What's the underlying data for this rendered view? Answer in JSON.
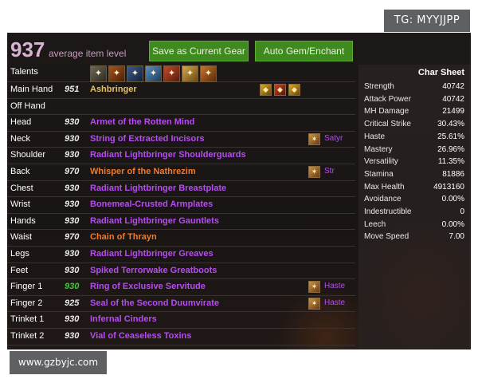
{
  "watermarks": {
    "top": "TG: MYYJJPP",
    "bottom": "www.gzbyjc.com"
  },
  "header": {
    "avg_ilvl": "937",
    "avg_label": "average item level",
    "save_button": "Save as Current Gear",
    "gem_button": "Auto Gem/Enchant"
  },
  "talents_label": "Talents",
  "talent_icons": [
    "talent-1",
    "talent-2",
    "talent-3",
    "talent-4",
    "talent-5",
    "talent-6",
    "talent-7"
  ],
  "gear": [
    {
      "slot": "Main Hand",
      "ilvl": "951",
      "item": "Ashbringer",
      "quality": "art",
      "relics": [
        "relic-holy",
        "relic-fire",
        "relic-holy"
      ]
    },
    {
      "slot": "Off Hand",
      "ilvl": "",
      "item": "",
      "quality": "epic"
    },
    {
      "slot": "Head",
      "ilvl": "930",
      "item": "Armet of the Rotten Mind",
      "quality": "epic"
    },
    {
      "slot": "Neck",
      "ilvl": "930",
      "item": "String of Extracted Incisors",
      "quality": "epic",
      "enchant": "Satyr"
    },
    {
      "slot": "Shoulder",
      "ilvl": "930",
      "item": "Radiant Lightbringer Shoulderguards",
      "quality": "epic"
    },
    {
      "slot": "Back",
      "ilvl": "970",
      "item": "Whisper of the Nathrezim",
      "quality": "leg",
      "enchant": "Str"
    },
    {
      "slot": "Chest",
      "ilvl": "930",
      "item": "Radiant Lightbringer Breastplate",
      "quality": "epic"
    },
    {
      "slot": "Wrist",
      "ilvl": "930",
      "item": "Bonemeal-Crusted Armplates",
      "quality": "epic"
    },
    {
      "slot": "Hands",
      "ilvl": "930",
      "item": "Radiant Lightbringer Gauntlets",
      "quality": "epic"
    },
    {
      "slot": "Waist",
      "ilvl": "970",
      "item": "Chain of Thrayn",
      "quality": "leg"
    },
    {
      "slot": "Legs",
      "ilvl": "930",
      "item": "Radiant Lightbringer Greaves",
      "quality": "epic"
    },
    {
      "slot": "Feet",
      "ilvl": "930",
      "item": "Spiked Terrorwake Greatboots",
      "quality": "epic"
    },
    {
      "slot": "Finger 1",
      "ilvl": "930",
      "ilvl_color": "green",
      "item": "Ring of Exclusive Servitude",
      "quality": "epic",
      "enchant": "Haste"
    },
    {
      "slot": "Finger 2",
      "ilvl": "925",
      "item": "Seal of the Second Duumvirate",
      "quality": "epic",
      "enchant": "Haste"
    },
    {
      "slot": "Trinket 1",
      "ilvl": "930",
      "item": "Infernal Cinders",
      "quality": "epic"
    },
    {
      "slot": "Trinket 2",
      "ilvl": "930",
      "item": "Vial of Ceaseless Toxins",
      "quality": "epic"
    }
  ],
  "char_sheet": {
    "title": "Char Sheet",
    "stats": [
      {
        "name": "Strength",
        "value": "40742"
      },
      {
        "name": "Attack Power",
        "value": "40742"
      },
      {
        "name": "MH Damage",
        "value": "21499"
      },
      {
        "name": "Critical Strike",
        "value": "30.43%"
      },
      {
        "name": "Haste",
        "value": "25.61%"
      },
      {
        "name": "Mastery",
        "value": "26.96%"
      },
      {
        "name": "Versatility",
        "value": "11.35%"
      },
      {
        "name": "Stamina",
        "value": "81886"
      },
      {
        "name": "Max Health",
        "value": "4913160"
      },
      {
        "name": "Avoidance",
        "value": "0.00%"
      },
      {
        "name": "Indestructible",
        "value": "0"
      },
      {
        "name": "Leech",
        "value": "0.00%"
      },
      {
        "name": "Move Speed",
        "value": "7.00"
      }
    ]
  },
  "colors": {
    "epic": "#b64cf0",
    "legendary": "#ef7b2a",
    "artifact": "#e5c26a",
    "button": "#3e8a1e",
    "ilvl_accent": "#d9b3d4"
  }
}
